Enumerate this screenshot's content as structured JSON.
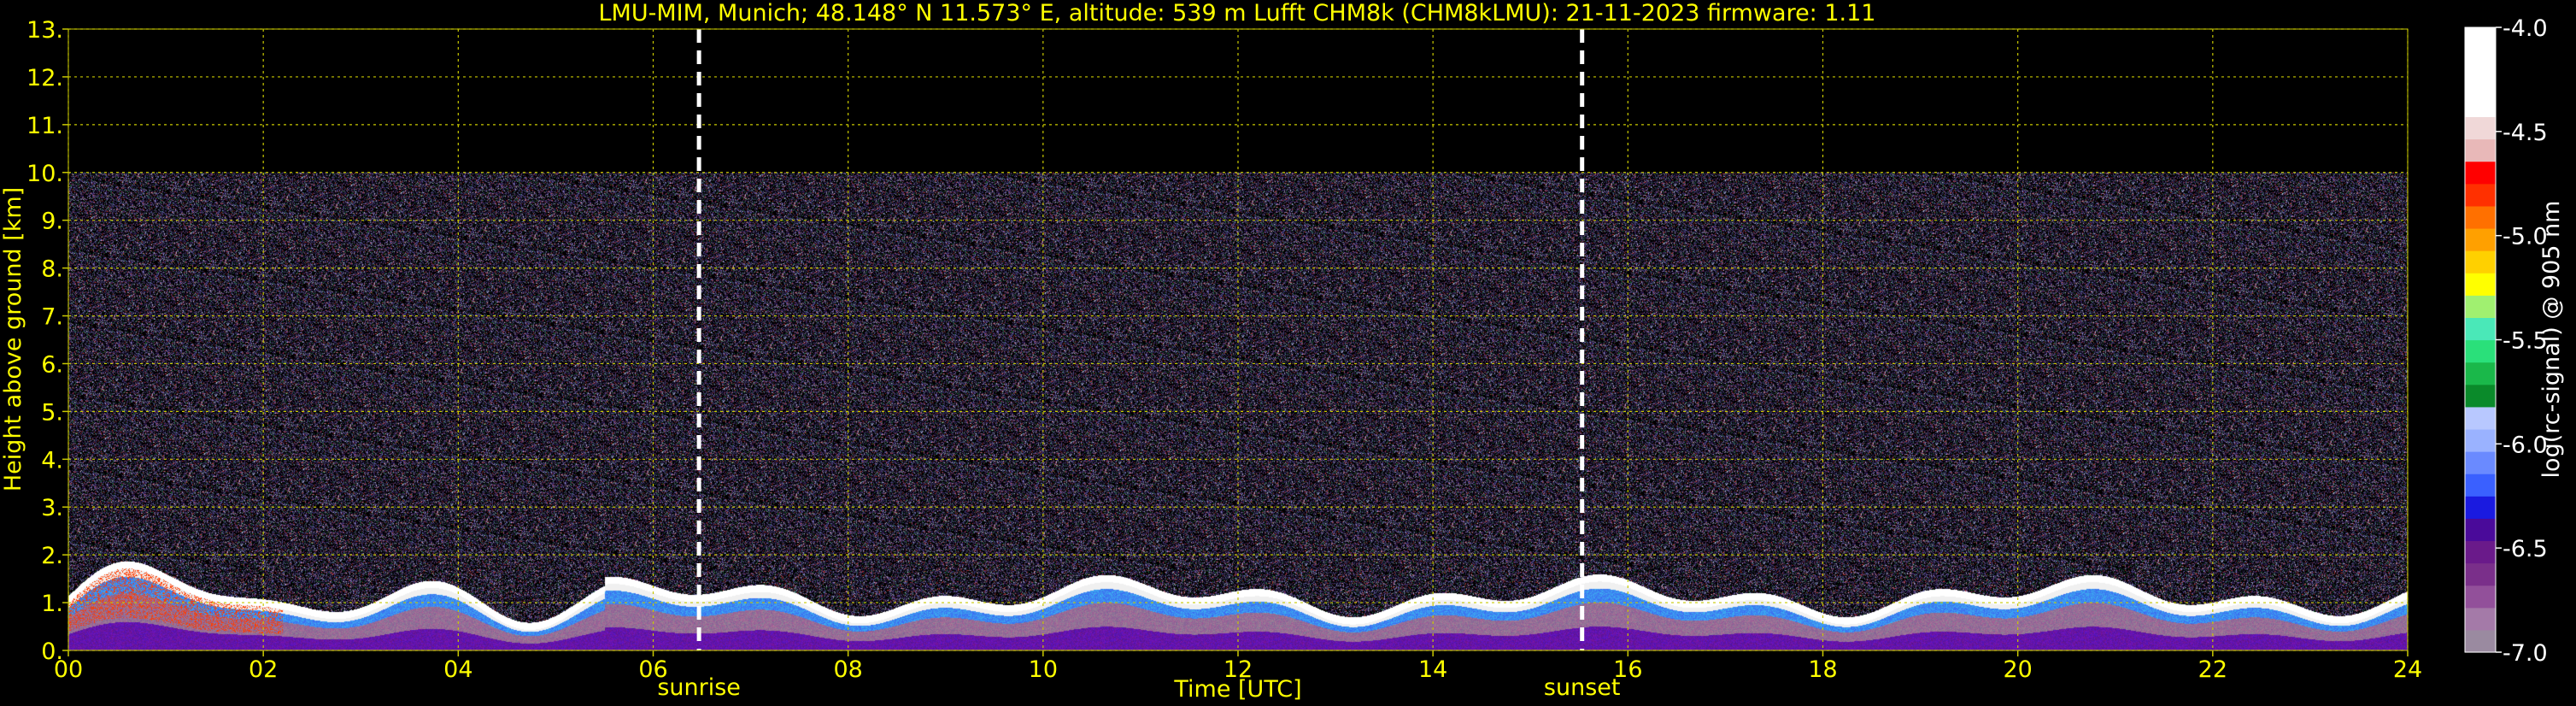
{
  "chart_data": {
    "type": "heatmap",
    "title": "LMU-MIM, Munich; 48.148° N 11.573° E, altitude: 539 m    Lufft CHM8k (CHM8kLMU): 21-11-2023    firmware: 1.11",
    "xlabel": "Time [UTC]",
    "ylabel": "Height above ground [km]",
    "xlim": [
      0,
      24
    ],
    "ylim": [
      0,
      13
    ],
    "x_ticks": [
      "00",
      "02",
      "04",
      "06",
      "08",
      "10",
      "12",
      "14",
      "16",
      "18",
      "20",
      "22",
      "24"
    ],
    "y_ticks": [
      "0.",
      "1.",
      "2.",
      "3.",
      "4.",
      "5.",
      "6.",
      "7.",
      "8.",
      "9.",
      "10.",
      "11.",
      "12.",
      "13."
    ],
    "grid": true,
    "data_top_km": 10,
    "markers": [
      {
        "label": "sunrise",
        "x": 6.47
      },
      {
        "label": "sunset",
        "x": 15.53
      }
    ],
    "colorbar": {
      "label": "log(rc-signal) @ 905 nm",
      "range": [
        -7.0,
        -4.0
      ],
      "ticks": [
        "-4.0",
        "-4.5",
        "-5.0",
        "-5.5",
        "-6.0",
        "-6.5",
        "-7.0"
      ],
      "colors": [
        "#9a8aa0",
        "#a47aa8",
        "#92509a",
        "#7a2f8a",
        "#6a1a8a",
        "#4a0a9a",
        "#1a1ae0",
        "#3a60ff",
        "#6a8aff",
        "#9ab2ff",
        "#b8c8ff",
        "#0a8a2a",
        "#1ab84a",
        "#2ae07a",
        "#4ae8b8",
        "#a0f070",
        "#ffff00",
        "#ffd000",
        "#ffa000",
        "#ff7000",
        "#ff3000",
        "#ff0000",
        "#e8b8b8",
        "#f0d8d8",
        "#ffffff",
        "#ffffff",
        "#ffffff",
        "#ffffff"
      ]
    },
    "colors": {
      "text": "#ffff00",
      "grid": "#c8c800",
      "background": "#000000"
    }
  }
}
